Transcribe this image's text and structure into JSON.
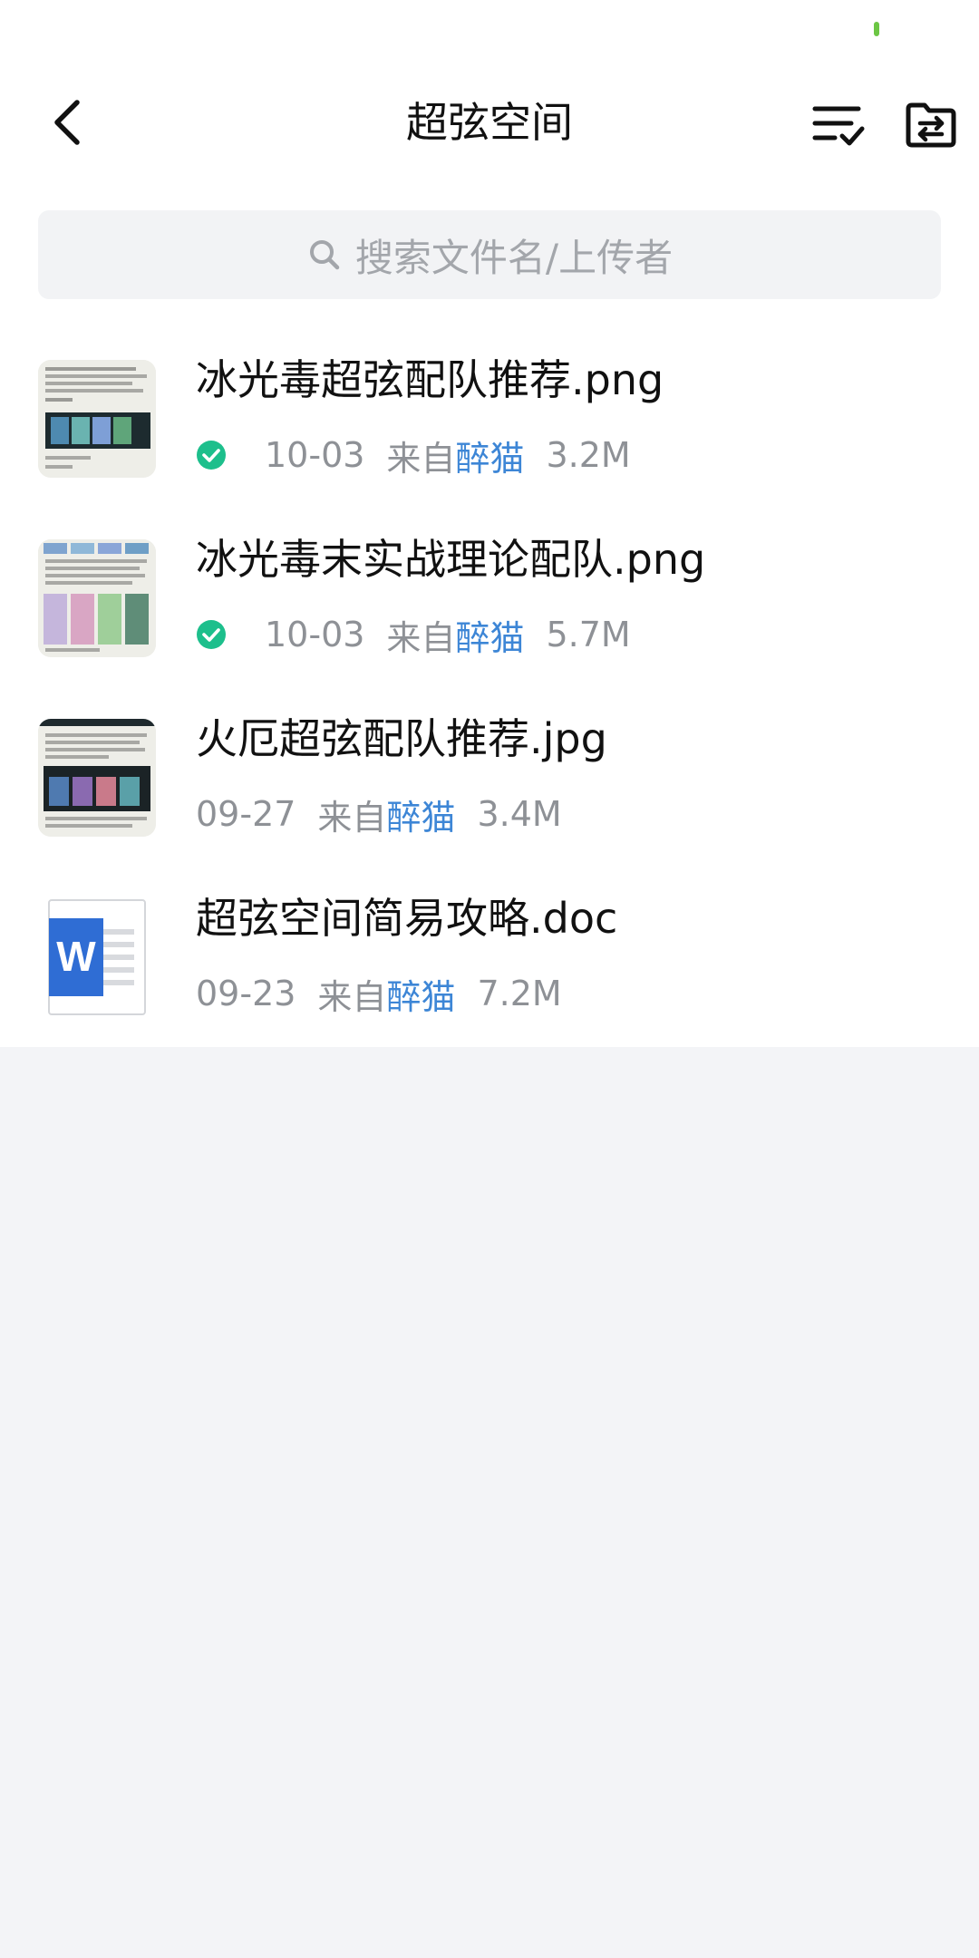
{
  "header": {
    "title": "超弦空间"
  },
  "search": {
    "placeholder": "搜索文件名/上传者"
  },
  "colors": {
    "check": "#1dbf8c",
    "user_link": "#3d86d6",
    "status_indicator": "#6cc644"
  },
  "files": [
    {
      "name": "冰光毒超弦配队推荐.png",
      "checked": true,
      "date": "10-03",
      "from_label": "来自",
      "uploader": "醉猫",
      "size": "3.2M",
      "icon": "image-thumbnail"
    },
    {
      "name": "冰光毒末实战理论配队.png",
      "checked": true,
      "date": "10-03",
      "from_label": "来自",
      "uploader": "醉猫",
      "size": "5.7M",
      "icon": "image-thumbnail"
    },
    {
      "name": "火厄超弦配队推荐.jpg",
      "checked": false,
      "date": "09-27",
      "from_label": "来自",
      "uploader": "醉猫",
      "size": "3.4M",
      "icon": "image-thumbnail"
    },
    {
      "name": "超弦空间简易攻略.doc",
      "checked": false,
      "date": "09-23",
      "from_label": "来自",
      "uploader": "醉猫",
      "size": "7.2M",
      "icon": "word-doc-icon"
    }
  ]
}
